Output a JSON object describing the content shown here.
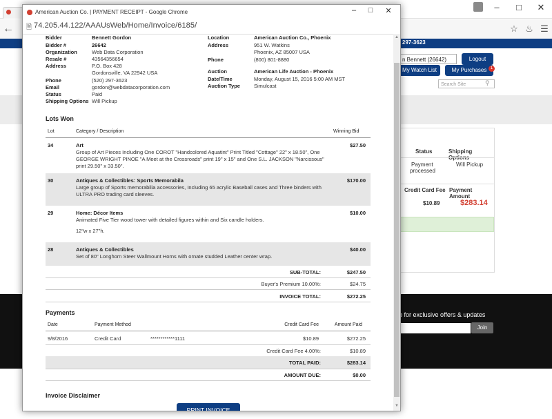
{
  "background": {
    "phone": ") 297-3623",
    "user_field": "n Bennett (26642)",
    "logout_label": "Logout",
    "watch_list_label": "My Watch List",
    "purchases_label": "My Purchases",
    "purchases_badge": "1",
    "search_placeholder": "Search Site",
    "panel": {
      "status_header": "Status",
      "shipping_header": "Shipping Options",
      "status_value_1": "Payment",
      "status_value_2": "processed",
      "shipping_value": "Will Pickup",
      "cc_fee_header": "Credit Card Fee",
      "payment_amount_header": "Payment Amount",
      "cc_fee_value": "$10.89",
      "payment_amount_value": "$283.14"
    },
    "footer_text": "p for exclusive offers & updates",
    "join_label": "Join",
    "accent_red": "#d23f31",
    "brand_blue": "#0e3e83"
  },
  "popup": {
    "title": "American Auction Co. | PAYMENT RECEIPT - Google Chrome",
    "url": "74.205.44.122/AAAUsWeb/Home/Invoice/6185/",
    "bidder": {
      "labels": {
        "bidder": "Bidder",
        "bidder_num": "Bidder #",
        "organization": "Organization",
        "resale": "Resale #",
        "address": "Address",
        "phone": "Phone",
        "email": "Email",
        "status": "Status",
        "shipping": "Shipping Options"
      },
      "name": "Bennett Gordon",
      "bidder_num": "26642",
      "organization": "Web Data Corporation",
      "resale": "43564356654",
      "address_1": "P.O. Box 428",
      "address_2": "Gordonsville, VA 22942 USA",
      "phone": "(520) 297-3623",
      "email": "gordon@webdatacorporation.com",
      "status": "Paid",
      "shipping": "Will Pickup"
    },
    "location": {
      "labels": {
        "location": "Location",
        "address": "Address",
        "phone": "Phone",
        "auction": "Auction",
        "datetime": "Date/Time",
        "auction_type": "Auction Type"
      },
      "name": "American Auction Co., Phoenix",
      "address_1": "951 W. Watkins",
      "address_2": "Phoenix, AZ 85007 USA",
      "phone": "(800) 801-8880",
      "auction": "American Life Auction - Phoenix",
      "datetime": "Monday, August 15, 2016 5:00 AM MST",
      "auction_type": "Simulcast"
    },
    "lots": {
      "heading": "Lots Won",
      "col_lot": "Lot",
      "col_category": "Category / Description",
      "col_bid": "Winning Bid",
      "rows": [
        {
          "lot": "34",
          "category": "Art",
          "desc": "Group of Art Pieces Including One COROT \"Handcolored Aquatint\" Print Titled \"Cottage\" 22\" x 18.50\", One GEORGE WRIGHT PINOE \"A Meet at the Crossroads\" print 19\" x 15\" and One S.L. JACKSON \"Narcissous\" print 29.50\" x 33.50\".",
          "extra": "",
          "bid": "$27.50"
        },
        {
          "lot": "30",
          "category": "Antiques & Collectibles: Sports Memorabila",
          "desc": "Large group of Sports memorabilia accessories, Including 65 acrylic Baseball cases and Three binders with ULTRA PRO trading card sleeves.",
          "extra": "",
          "bid": "$170.00"
        },
        {
          "lot": "29",
          "category": "Home: Décor Items",
          "desc": "Animated Five Tier wood tower with detailed figures within and Six candle holders.",
          "extra": "12\"w x 27\"h.",
          "bid": "$10.00"
        },
        {
          "lot": "28",
          "category": "Antiques & Collectibles",
          "desc": "Set of 80\" Longhorn Steer Wallmount Horns with ornate studded Leather center wrap.",
          "extra": "",
          "bid": "$40.00"
        }
      ],
      "subtotal_label": "SUB-TOTAL:",
      "subtotal": "$247.50",
      "premium_label": "Buyer's Premium 10.00%:",
      "premium": "$24.75",
      "invoice_total_label": "INVOICE TOTAL:",
      "invoice_total": "$272.25"
    },
    "payments": {
      "heading": "Payments",
      "col_date": "Date",
      "col_method": "Payment Method",
      "col_fee": "Credit Card Fee",
      "col_amount": "Amount Paid",
      "row_date": "9/8/2016",
      "row_method": "Credit Card",
      "row_card": "************1111",
      "row_fee": "$10.89",
      "row_amount": "$272.25",
      "ccfee_label": "Credit Card Fee 4.00%:",
      "ccfee": "$10.89",
      "total_paid_label": "TOTAL PAID:",
      "total_paid": "$283.14",
      "amount_due_label": "AMOUNT DUE:",
      "amount_due": "$0.00"
    },
    "disclaimer_heading": "Invoice Disclaimer",
    "print_label": "PRINT INVOICE"
  }
}
